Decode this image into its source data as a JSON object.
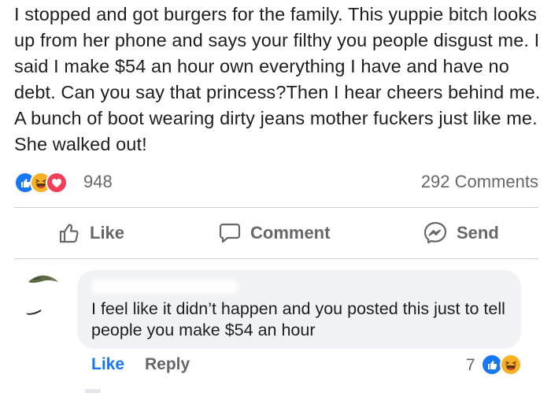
{
  "post": {
    "text": "I stopped and got burgers for the family. This yuppie bitch looks up from her phone and says your filthy you people disgust me. I said I make $54 an hour own everything I have and have no debt. Can you say that princess?Then I hear cheers behind me. A bunch of boot wearing dirty jeans mother fuckers just like me. She walked out!"
  },
  "reactions": {
    "icons": [
      "like-reaction-icon",
      "haha-reaction-icon",
      "love-reaction-icon"
    ],
    "count": "948",
    "comments_label": "292 Comments"
  },
  "actions": {
    "like_label": "Like",
    "comment_label": "Comment",
    "send_label": "Send"
  },
  "comment": {
    "text": "I feel like it didn’t happen and you posted this just to tell people you make $54 an hour",
    "like_label": "Like",
    "reply_label": "Reply",
    "reaction_count": "7",
    "reaction_icons": [
      "like-reaction-icon",
      "haha-reaction-icon"
    ]
  },
  "colors": {
    "like_blue": "#1877f2",
    "haha_yellow": "#f7b125",
    "love_red": "#f33e58",
    "secondary_text": "#65676b",
    "bubble_bg": "#f0f2f5"
  }
}
